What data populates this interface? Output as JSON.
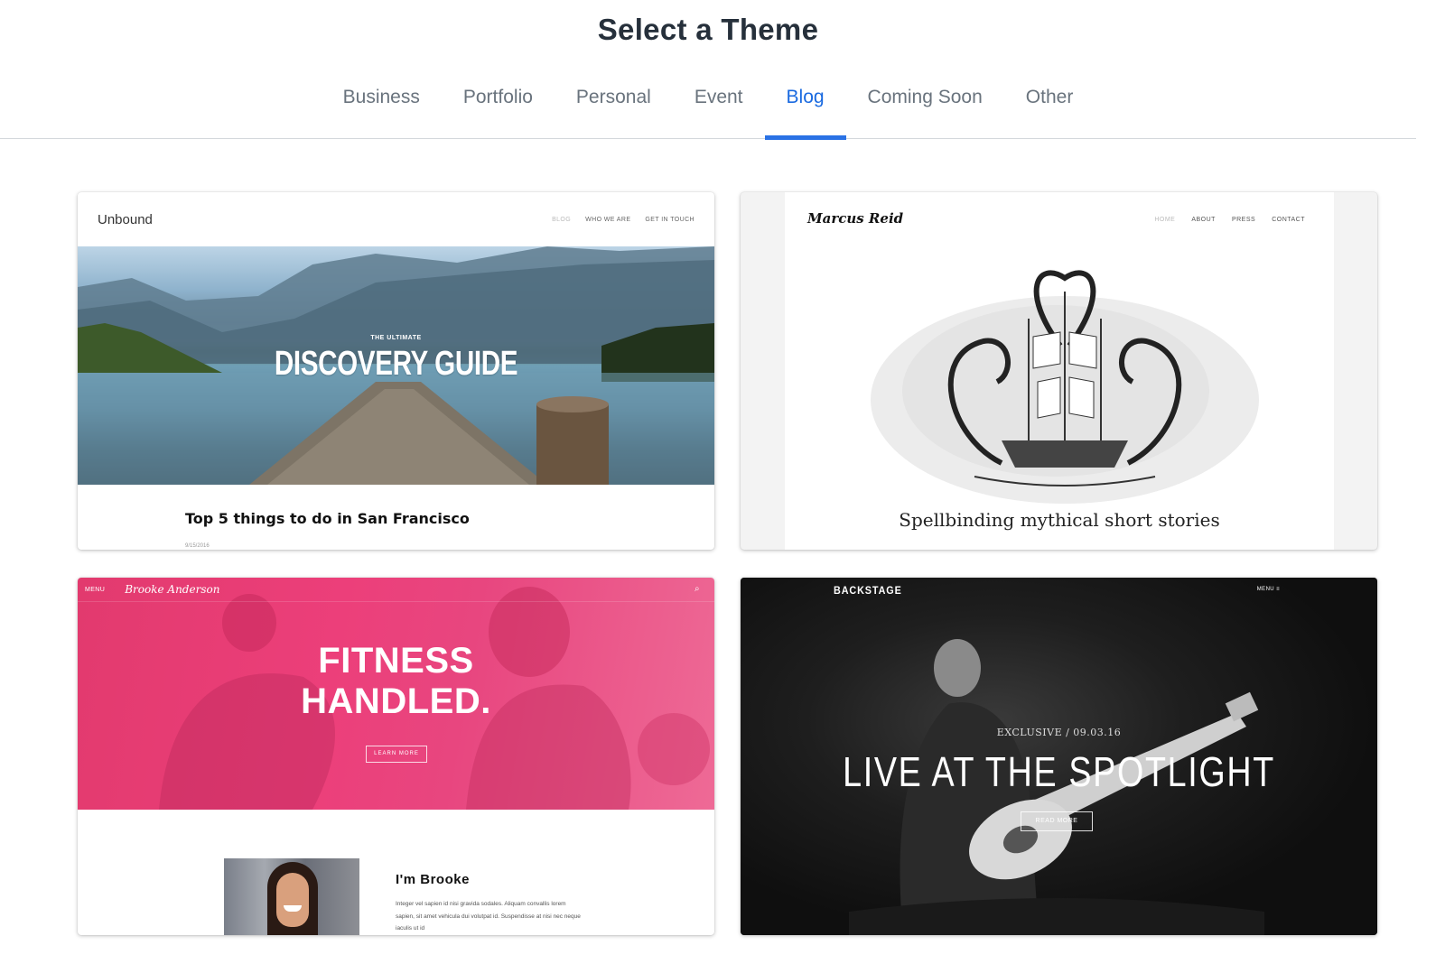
{
  "page": {
    "title": "Select a Theme"
  },
  "tabs": [
    {
      "label": "Business",
      "active": false
    },
    {
      "label": "Portfolio",
      "active": false
    },
    {
      "label": "Personal",
      "active": false
    },
    {
      "label": "Event",
      "active": false
    },
    {
      "label": "Blog",
      "active": true
    },
    {
      "label": "Coming Soon",
      "active": false
    },
    {
      "label": "Other",
      "active": false
    }
  ],
  "colors": {
    "accent": "#2a72e5",
    "tab_text": "#69737d",
    "title_text": "#26303b",
    "brooke_pink": "#e93a74",
    "backstage_dark": "#111111"
  },
  "themes": {
    "unbound": {
      "logo": "Unbound",
      "nav": [
        "BLOG",
        "WHO WE ARE",
        "GET IN TOUCH"
      ],
      "hero_kicker": "THE ULTIMATE",
      "hero_headline": "DISCOVERY GUIDE",
      "post_title": "Top 5 things to do in San Francisco",
      "post_date": "9/15/2016"
    },
    "marcus": {
      "logo": "Marcus Reid",
      "nav": [
        "HOME",
        "ABOUT",
        "PRESS",
        "CONTACT"
      ],
      "tagline": "Spellbinding mythical short stories"
    },
    "brooke": {
      "menu": "MENU",
      "logo": "Brooke Anderson",
      "search_icon": "search-icon",
      "headline_line1": "FITNESS",
      "headline_line2": "HANDLED.",
      "button": "LEARN MORE",
      "about_title": "I'm Brooke",
      "about_body": "Integer vel sapien id nisi gravida sodales. Aliquam convallis lorem sapien, sit amet vehicula dui volutpat id. Suspendisse at nisi nec neque iaculis ut id"
    },
    "backstage": {
      "logo": "BACKSTAGE",
      "menu": "MENU ≡",
      "kicker": "EXCLUSIVE / 09.03.16",
      "headline": "LIVE AT THE SPOTLIGHT",
      "button": "READ MORE"
    }
  }
}
